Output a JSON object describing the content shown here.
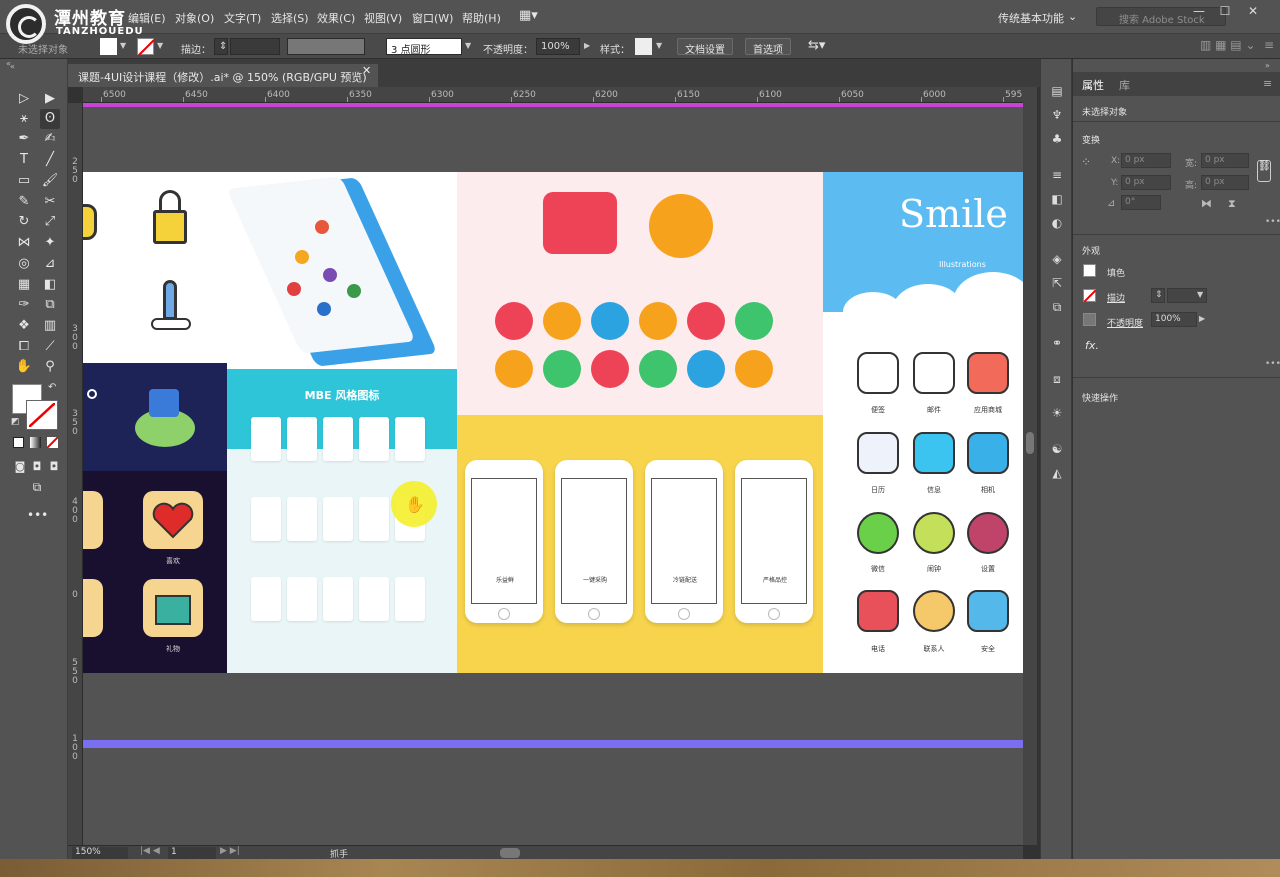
{
  "brand": {
    "cn": "潭州教育",
    "en": "TANZHOUEDU"
  },
  "menu": {
    "items": [
      "编辑(E)",
      "对象(O)",
      "文字(T)",
      "选择(S)",
      "效果(C)",
      "视图(V)",
      "窗口(W)",
      "帮助(H)"
    ]
  },
  "workspace": "传统基本功能",
  "search": {
    "placeholder": "搜索 Adobe Stock"
  },
  "control_bar": {
    "selection_label": "未选择对象",
    "stroke_label": "描边：",
    "brush_label": "3 点圆形",
    "opacity_label": "不透明度：",
    "opacity_value": "100%",
    "style_label": "样式：",
    "doc_setup": "文档设置",
    "preferences": "首选项"
  },
  "document": {
    "tab_title": "课题-4UI设计课程（修改）.ai* @ 150% (RGB/GPU 预览)",
    "ruler_ticks": [
      "6500",
      "6450",
      "6400",
      "6350",
      "6300",
      "6250",
      "6200",
      "6150",
      "6100",
      "6050",
      "6000",
      "595"
    ],
    "vruler_labels": [
      "2\n5\n0",
      "3\n0\n0",
      "3\n5\n0",
      "4\n0\n0",
      "5\n0\n0",
      "0",
      "5\n5\n0",
      "1\n0\n0"
    ]
  },
  "artwork": {
    "icon_labels": [
      "喜欢",
      "礼物"
    ],
    "card_header": "MBE 风格图标",
    "phone_captions": [
      "乐益鲜",
      "一键采购",
      "冷链配送",
      "严格品控"
    ],
    "smile_title": "Smile",
    "smile_sub": "Illustrations",
    "app_labels": [
      "便签",
      "邮件",
      "应用商城",
      "日历",
      "信息",
      "相机",
      "微信",
      "闹钟",
      "设置",
      "电话",
      "联系人",
      "安全"
    ]
  },
  "status": {
    "zoom": "150%",
    "artboard": "1",
    "tool": "抓手"
  },
  "properties": {
    "tab_properties": "属性",
    "tab_library": "库",
    "selection": "未选择对象",
    "transform": "变换",
    "x_label": "X:",
    "y_label": "Y:",
    "w_label": "宽:",
    "h_label": "高:",
    "zero": "0 px",
    "angle": "0°",
    "appearance": "外观",
    "fill": "填色",
    "stroke": "描边",
    "opacity": "不透明度",
    "opacity_value": "100%",
    "fx": "fx.",
    "quick_actions": "快速操作"
  },
  "colors": {
    "guide_top": "#c944d6",
    "guide_bottom": "#7a6ff0",
    "panel": "#535353"
  }
}
